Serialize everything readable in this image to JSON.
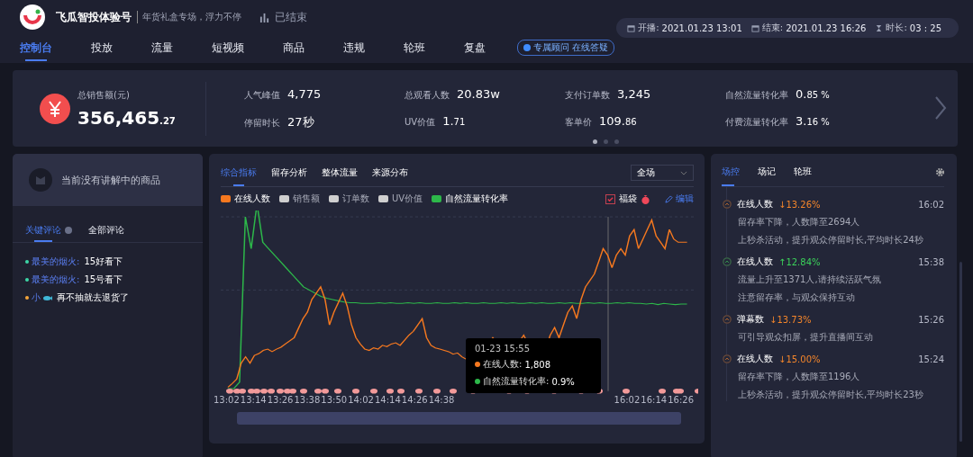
{
  "header": {
    "account": "飞瓜智投体验号",
    "subtitle": "年货礼盒专场，浮力不停",
    "status": "已结束",
    "start_label": "开播:",
    "start": "2021.01.23 13:01",
    "end_label": "结束:",
    "end": "2021.01.23 16:26",
    "duration_label": "时长:",
    "duration": "03 : 25"
  },
  "nav": [
    {
      "label": "控制台",
      "selected": true
    },
    {
      "label": "投放",
      "selected": false
    },
    {
      "label": "流量",
      "selected": false
    },
    {
      "label": "短视频",
      "selected": false
    },
    {
      "label": "商品",
      "selected": false
    },
    {
      "label": "违规",
      "selected": false
    },
    {
      "label": "轮班",
      "selected": false
    },
    {
      "label": "复盘",
      "selected": false
    }
  ],
  "advisor_badge": "专属顾问 在线答疑",
  "summary": {
    "label": "总销售额(元)",
    "value": "356,465",
    "small": ".27",
    "stats": [
      {
        "label": "人气峰值",
        "value": "4,775"
      },
      {
        "label": "总观看人数",
        "value": "20.83w"
      },
      {
        "label": "支付订单数",
        "value": "3,245"
      },
      {
        "label": "自然流量转化率",
        "value": "0.",
        "small": "85 %"
      },
      {
        "label": "停留时长",
        "value": "27秒"
      },
      {
        "label": "UV价值",
        "value": "1.",
        "small": "71"
      },
      {
        "label": "客单价",
        "value": "109.",
        "small": "86"
      },
      {
        "label": "付费流量转化率",
        "value": "3.",
        "small": "16 %"
      }
    ],
    "pages": [
      {
        "selected": true
      },
      {
        "selected": false
      },
      {
        "selected": false
      }
    ]
  },
  "product": {
    "empty_text": "当前没有讲解中的商品"
  },
  "comment_tabs": [
    {
      "label": "关键评论",
      "selected": true
    },
    {
      "label": "全部评论",
      "selected": false
    }
  ],
  "comments": [
    {
      "user": "最美的烟火:",
      "text": "15好看下",
      "color": "#3dd6a6"
    },
    {
      "user": "最美的烟火:",
      "text": "15号看下",
      "color": "#3dd6a6"
    },
    {
      "user": "小",
      "text": "再不抽就去退货了",
      "color": "#f5a53a"
    }
  ],
  "chart_tabs": [
    {
      "label": "综合指标",
      "selected": true
    },
    {
      "label": "留存分析",
      "selected": false
    },
    {
      "label": "整体流量",
      "selected": false
    },
    {
      "label": "来源分布",
      "selected": false
    }
  ],
  "scope_select": "全场",
  "legend": [
    {
      "label": "在线人数",
      "color": "#f5781f"
    },
    {
      "label": "销售额",
      "color": "#cfcfcf"
    },
    {
      "label": "订单数",
      "color": "#cfcfcf"
    },
    {
      "label": "UV价值",
      "color": "#cfcfcf"
    },
    {
      "label": "自然流量转化率",
      "color": "#2db84a"
    }
  ],
  "lucky_bag": {
    "label": "福袋",
    "checked": true
  },
  "edit_link": "编辑",
  "x_labels_left": [
    "13:02",
    "13:14",
    "13:26",
    "13:38",
    "13:50",
    "14:02",
    "14:14",
    "14:26",
    "14:38"
  ],
  "x_labels_right": [
    "16:02",
    "16:14",
    "16:26"
  ],
  "tooltip": {
    "time": "01-23 15:55",
    "rows": [
      {
        "label": "在线人数:",
        "value": "1,808",
        "color": "#f5781f"
      },
      {
        "label": "自然流量转化率:",
        "value": "0.9%",
        "color": "#2db84a"
      }
    ]
  },
  "side_tabs": [
    {
      "label": "场控",
      "selected": true
    },
    {
      "label": "场记",
      "selected": false
    },
    {
      "label": "轮班",
      "selected": false
    }
  ],
  "events": [
    {
      "title": "在线人数",
      "kind": "down",
      "change": "↓13.26%",
      "time": "16:02",
      "notes": [
        "留存率下降，人数降至2694人",
        "上秒杀活动，提升观众停留时长,平均时长24秒"
      ]
    },
    {
      "title": "在线人数",
      "kind": "up",
      "change": "↑12.84%",
      "time": "15:38",
      "notes": [
        "流量上升至1371人,请持续活跃气氛",
        "注意留存率，与观众保持互动"
      ]
    },
    {
      "title": "弹幕数",
      "kind": "down",
      "change": "↓13.73%",
      "time": "15:26",
      "notes": [
        "可引导观众扣屏，提升直播间互动"
      ]
    },
    {
      "title": "在线人数",
      "kind": "down",
      "change": "↓15.00%",
      "time": "15:24",
      "notes": [
        "留存率下降，人数降至1196人",
        "上秒杀活动，提升观众停留时长,平均时长23秒"
      ]
    }
  ]
}
